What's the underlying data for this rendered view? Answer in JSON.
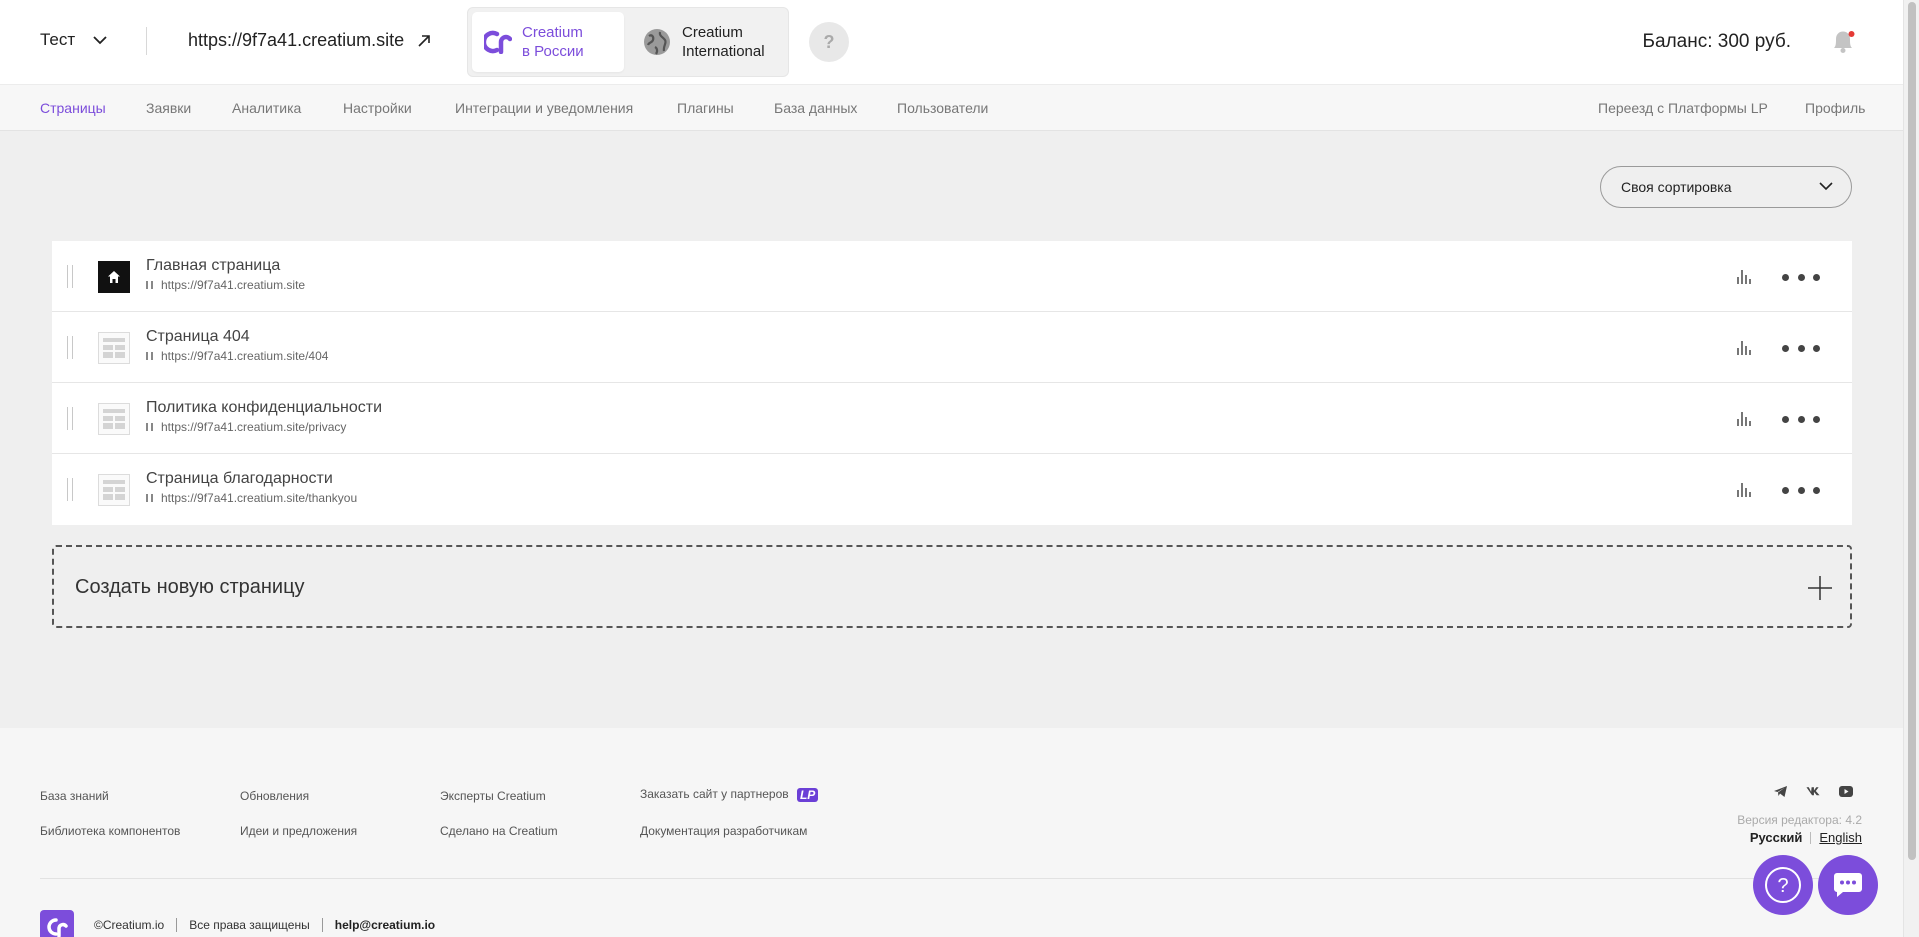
{
  "header": {
    "project_name": "Тест",
    "site_url": "https://9f7a41.creatium.site",
    "region_russia": {
      "line1": "Creatium",
      "line2": "в России"
    },
    "region_international": {
      "line1": "Creatium",
      "line2": "International"
    },
    "help_label": "?",
    "balance": "Баланс: 300 руб."
  },
  "nav": {
    "items": [
      "Страницы",
      "Заявки",
      "Аналитика",
      "Настройки",
      "Интеграции и уведомления",
      "Плагины",
      "База данных",
      "Пользователи"
    ],
    "active": "Страницы",
    "right_items": [
      "Переезд с Платформы LP",
      "Профиль"
    ]
  },
  "sort": {
    "selected": "Своя сортировка"
  },
  "pages": [
    {
      "title": "Главная страница",
      "url": "https://9f7a41.creatium.site",
      "thumbnail": "home-icon"
    },
    {
      "title": "Страница 404",
      "url": "https://9f7a41.creatium.site/404",
      "thumbnail": "page-layout-icon"
    },
    {
      "title": "Политика конфиденциальности",
      "url": "https://9f7a41.creatium.site/privacy",
      "thumbnail": "page-layout-icon"
    },
    {
      "title": "Страница благодарности",
      "url": "https://9f7a41.creatium.site/thankyou",
      "thumbnail": "page-layout-icon"
    }
  ],
  "create": {
    "label": "Создать новую страницу"
  },
  "footer": {
    "col1": [
      "База знаний",
      "Библиотека компонентов"
    ],
    "col2": [
      "Обновления",
      "Идеи и предложения"
    ],
    "col3": [
      "Эксперты Creatium",
      "Сделано на Creatium"
    ],
    "col4": [
      "Заказать сайт у партнеров",
      "Документация разработчикам"
    ],
    "lp_badge": "LP",
    "socials": [
      "telegram-icon",
      "vk-icon",
      "youtube-icon"
    ],
    "version": "Версия редактора: 4.2",
    "lang_ru": "Русский",
    "lang_en": "English",
    "copyright": "©Creatium.io",
    "rights": "Все права защищены",
    "email": "help@creatium.io"
  },
  "fabs": {
    "help": "?"
  },
  "colors": {
    "accent": "#7c4ddb",
    "notification_dot": "#e53935"
  }
}
